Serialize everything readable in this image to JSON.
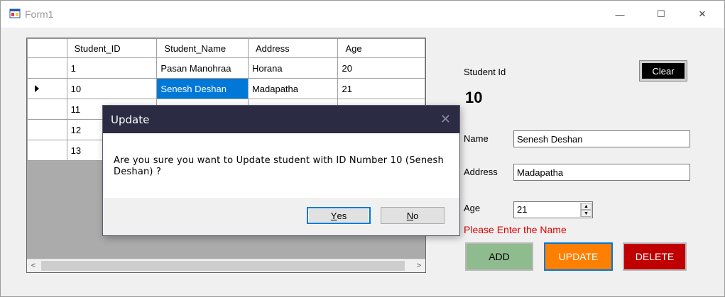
{
  "window": {
    "title": "Form1",
    "min_glyph": "—",
    "max_glyph": "☐",
    "close_glyph": "✕"
  },
  "grid": {
    "columns": [
      "Student_ID",
      "Student_Name",
      "Address",
      "Age"
    ],
    "rows": [
      {
        "id": "1",
        "name": "Pasan Manohraa",
        "address": "Horana",
        "age": "20"
      },
      {
        "id": "10",
        "name": "Senesh Deshan",
        "address": "Madapatha",
        "age": "21",
        "selected": true
      },
      {
        "id": "11",
        "name": "",
        "address": "",
        "age": ""
      },
      {
        "id": "12",
        "name": "",
        "address": "",
        "age": ""
      },
      {
        "id": "13",
        "name": "",
        "address": "",
        "age": ""
      }
    ],
    "scroll_left": "<",
    "scroll_right": ">"
  },
  "form": {
    "student_id_label": "Student Id",
    "student_id_value": "10",
    "clear_label": "Clear",
    "name_label": "Name",
    "name_value": "Senesh Deshan",
    "address_label": "Address",
    "address_value": "Madapatha",
    "age_label": "Age",
    "age_value": "21",
    "error_text": "Please Enter the Name",
    "add_label": "ADD",
    "update_label": "UPDATE",
    "delete_label": "DELETE"
  },
  "dialog": {
    "title": "Update",
    "message": "Are you sure you want to Update student with ID Number 10 (Senesh Deshan) ?",
    "yes_first": "Y",
    "yes_rest": "es",
    "no_first": "N",
    "no_rest": "o"
  },
  "colors": {
    "selection": "#0078d7",
    "dialog_title_bg": "#2b2b44",
    "add_bg": "#8fbc8f",
    "update_bg": "#ff8000",
    "delete_bg": "#c00000",
    "error": "#e00000"
  }
}
